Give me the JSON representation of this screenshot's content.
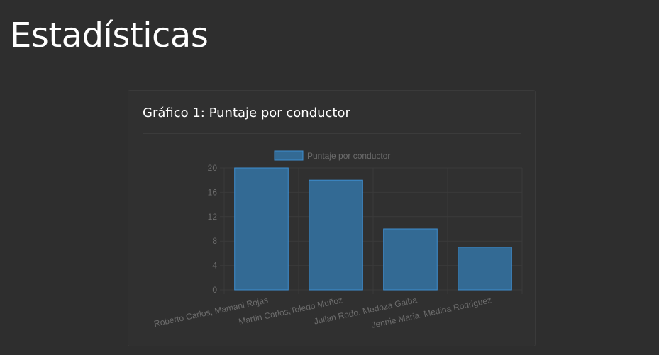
{
  "page": {
    "title": "Estadísticas"
  },
  "card": {
    "title": "Gráfico 1: Puntaje por conductor"
  },
  "colors": {
    "background": "#2e2e2e",
    "bar_fill": "#336a94",
    "bar_border": "#3e8ed0",
    "grid": "#3a3a3a",
    "tick_text": "#6c6c6c"
  },
  "chart_data": {
    "type": "bar",
    "categories": [
      "Roberto Carlos, Mamani Rojas",
      "Martin Carlos,Toledo Muñoz",
      "Julian Rodo, Medoza Galba",
      "Jennie Maria, Medina Rodriguez"
    ],
    "series": [
      {
        "name": "Puntaje por conductor",
        "values": [
          20,
          18,
          10,
          7
        ]
      }
    ],
    "title": "",
    "xlabel": "",
    "ylabel": "",
    "ylim": [
      0,
      20
    ],
    "yticks": [
      "0",
      "4",
      "8",
      "12",
      "16",
      "20"
    ],
    "grid": true,
    "legend_position": "top"
  }
}
